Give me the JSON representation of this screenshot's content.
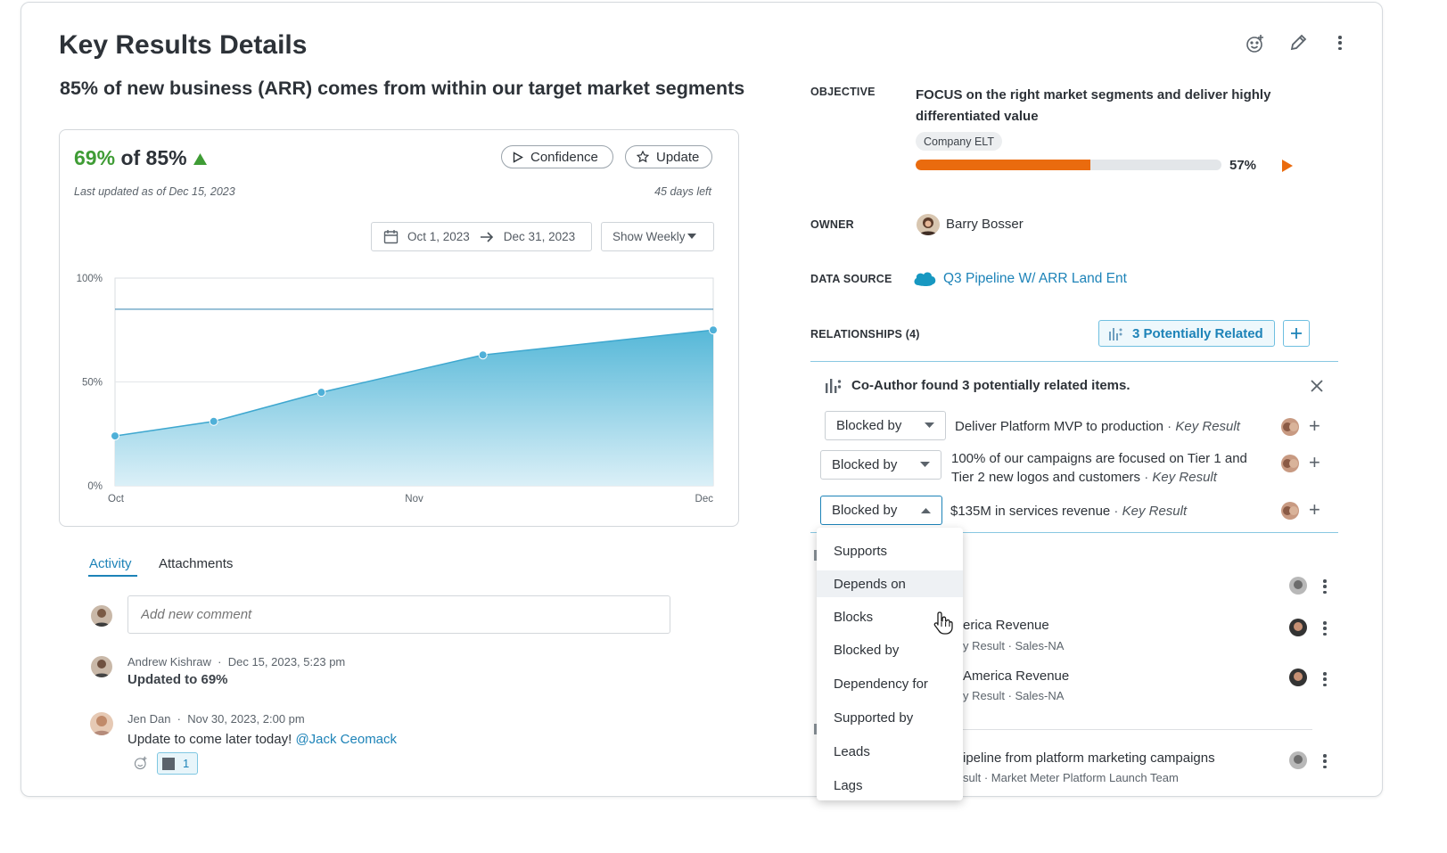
{
  "header": {
    "title": "Key Results Details",
    "subtitle": "85% of new business (ARR) comes from within our target market segments"
  },
  "progress_card": {
    "current": "69%",
    "of_target": "of 85%",
    "confidence_label": "Confidence",
    "update_label": "Update",
    "last_updated": "Last updated as of Dec 15, 2023",
    "days_left": "45 days left",
    "date_start": "Oct 1, 2023",
    "date_end": "Dec 31, 2023",
    "show_select": "Show Weekly"
  },
  "chart_data": {
    "type": "area",
    "x": [
      "Oct",
      "Nov",
      "Dec"
    ],
    "xlabel": "",
    "ylabel": "",
    "yticks": [
      "100%",
      "50%",
      "0%"
    ],
    "ylim": [
      0,
      100
    ],
    "target": 85,
    "series": [
      {
        "points": [
          [
            0,
            24
          ],
          [
            0.33,
            31
          ],
          [
            0.69,
            45
          ],
          [
            1.23,
            63
          ],
          [
            2.0,
            75
          ]
        ]
      }
    ],
    "grid": true,
    "colors": {
      "area_top": "#4db4d6",
      "area_bottom": "#d9eff7",
      "line": "#3ea7cf",
      "target_line": "#4a90b8"
    }
  },
  "tabs": [
    {
      "label": "Activity",
      "active": true
    },
    {
      "label": "Attachments",
      "active": false
    }
  ],
  "comment_input": {
    "placeholder": "Add new comment"
  },
  "activity": [
    {
      "author": "Andrew Kishraw",
      "time": "Dec 15, 2023, 5:23 pm",
      "text": "Updated to 69%"
    },
    {
      "author": "Jen Dan",
      "time": "Nov 30, 2023, 2:00 pm",
      "text": "Update to come later today! ",
      "mention": "@Jack Ceomack",
      "reaction_count": "1"
    }
  ],
  "details": {
    "objective_label": "OBJECTIVE",
    "objective_text_1": "FOCUS on the right market segments and deliver highly",
    "objective_text_2": "differentiated value",
    "objective_tag": "Company ELT",
    "objective_progress": 57,
    "objective_progress_text": "57%",
    "owner_label": "OWNER",
    "owner_name": "Barry Bosser",
    "data_source_label": "DATA SOURCE",
    "data_source_name": "Q3 Pipeline W/ ARR Land Ent",
    "data_source_icon": "salesforce",
    "relationships_label": "RELATIONSHIPS (4)",
    "potentially_related_label": "3 Potentially Related"
  },
  "coauthor": {
    "heading": "Co-Author found 3 potentially related items.",
    "items": [
      {
        "relation": "Blocked by",
        "text": "Deliver Platform MVP to production",
        "type": "Key Result"
      },
      {
        "relation": "Blocked by",
        "text_1": "100% of our campaigns are focused on Tier 1 and",
        "text_2": "Tier 2 new logos and customers",
        "type": "Key Result"
      },
      {
        "relation": "Blocked by",
        "text": "$135M in services revenue",
        "type": "Key Result"
      }
    ]
  },
  "relation_menu": {
    "options": [
      "Supports",
      "Depends on",
      "Blocks",
      "Blocked by",
      "Dependency for",
      "Supported by",
      "Leads",
      "Lags"
    ],
    "highlighted": "Depends on"
  },
  "background_relationships": [
    {
      "title": "erica Revenue",
      "sub": "y Result · Sales-NA"
    },
    {
      "title": "America Revenue",
      "sub": "y Result · Sales-NA"
    },
    {
      "title": "ipeline from platform marketing campaigns",
      "sub": "sult · Market Meter Platform Launch Team"
    }
  ],
  "colors": {
    "accent_green": "#3f9c35",
    "accent_blue": "#1b7fb5",
    "progress_orange": "#ea6b0e",
    "link_blue": "#1d83b8"
  }
}
